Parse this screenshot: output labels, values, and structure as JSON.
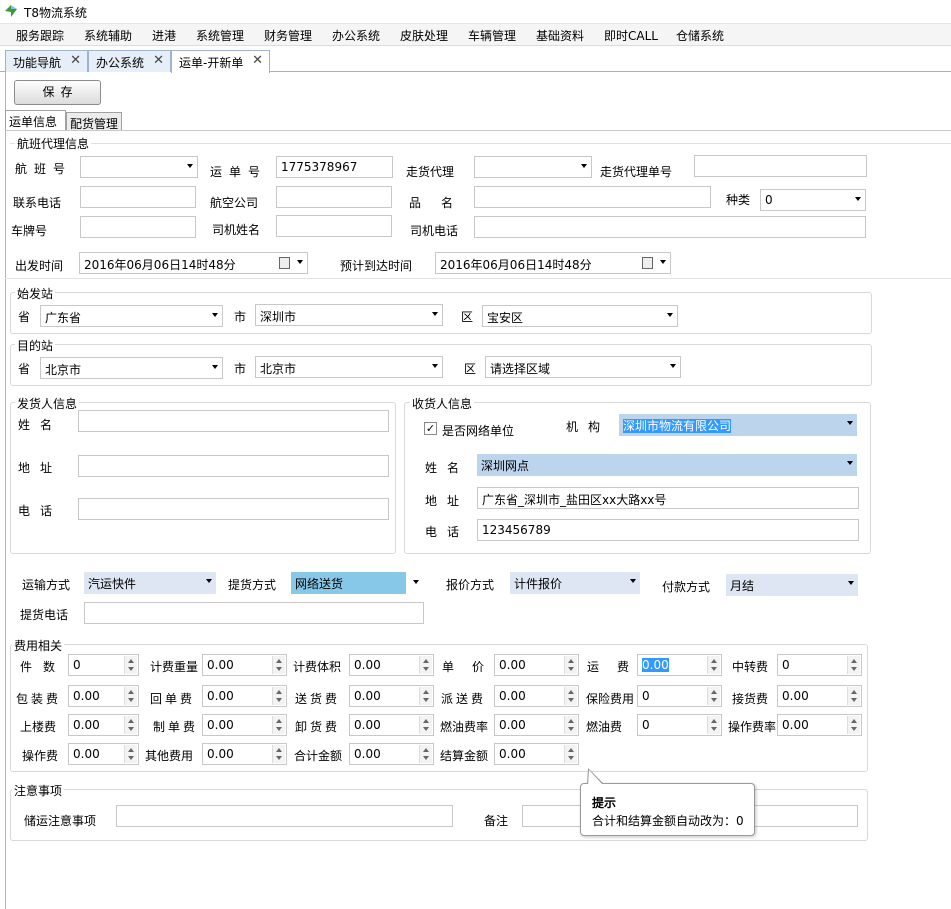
{
  "app": {
    "title": "T8物流系统"
  },
  "menu": [
    "服务跟踪",
    "系统辅助",
    "进港",
    "系统管理",
    "财务管理",
    "办公系统",
    "皮肤处理",
    "车辆管理",
    "基础资料",
    "即时CALL",
    "仓储系统"
  ],
  "tabs": [
    {
      "label": "功能导航",
      "close": "✕"
    },
    {
      "label": "办公系统",
      "close": "✕"
    },
    {
      "label": "运单-开新单",
      "close": "✕"
    }
  ],
  "toolbar": {
    "save_label": "保存"
  },
  "subtabs": [
    "运单信息",
    "配货管理"
  ],
  "flight": {
    "group_title": "航班代理信息",
    "flight_no_label": "航班号",
    "flight_no": "",
    "waybill_no_label": "运单号",
    "waybill_no": "1775378967",
    "agent_label": "走货代理",
    "agent": "",
    "agent_bill_label": "走货代理单号",
    "agent_bill": "",
    "phone_label": "联系电话",
    "phone": "",
    "airline_label": "航空公司",
    "airline": "",
    "goods_name_label": "品名",
    "goods_name": "",
    "type_label": "种类",
    "type": "0",
    "plate_label": "车牌号",
    "plate": "",
    "driver_label": "司机姓名",
    "driver": "",
    "driver_phone_label": "司机电话",
    "driver_phone": "",
    "depart_label": "出发时间",
    "depart": "2016年06月06日14时48分",
    "arrive_label": "预计到达时间",
    "arrive": "2016年06月06日14时48分"
  },
  "origin": {
    "group_title": "始发站",
    "prov_label": "省",
    "prov": "广东省",
    "city_label": "市",
    "city": "深圳市",
    "dist_label": "区",
    "dist": "宝安区"
  },
  "dest": {
    "group_title": "目的站",
    "prov_label": "省",
    "prov": "北京市",
    "city_label": "市",
    "city": "北京市",
    "dist_label": "区",
    "dist": "请选择区域"
  },
  "sender": {
    "group_title": "发货人信息",
    "name_label": "姓名",
    "name": "",
    "addr_label": "地址",
    "addr": "",
    "phone_label": "电话",
    "phone": ""
  },
  "receiver": {
    "group_title": "收货人信息",
    "network_label": "是否网络单位",
    "network_checked": "✓",
    "org_label": "机构",
    "org": "深圳市物流有限公司",
    "name_label": "姓名",
    "name": "深圳网点",
    "addr_label": "地址",
    "addr": "广东省_深圳市_盐田区xx大路xx号",
    "phone_label": "电话",
    "phone": "123456789"
  },
  "shipping": {
    "transport_label": "运输方式",
    "transport": "汽运快件",
    "pickup_label": "提货方式",
    "pickup": "网络送货",
    "quote_label": "报价方式",
    "quote": "计件报价",
    "pay_label": "付款方式",
    "pay": "月结",
    "pickup_phone_label": "提货电话",
    "pickup_phone": ""
  },
  "fees": {
    "group_title": "费用相关",
    "rows": [
      [
        {
          "label": "件数",
          "value": "0"
        },
        {
          "label": "计费重量",
          "value": "0.00"
        },
        {
          "label": "计费体积",
          "value": "0.00"
        },
        {
          "label": "单价",
          "value": "0.00"
        },
        {
          "label": "运费",
          "value": "0.00"
        },
        {
          "label": "中转费",
          "value": "0"
        }
      ],
      [
        {
          "label": "包装费",
          "value": "0.00"
        },
        {
          "label": "回单费",
          "value": "0.00"
        },
        {
          "label": "送货费",
          "value": "0.00"
        },
        {
          "label": "派送费",
          "value": "0.00"
        },
        {
          "label": "保险费用",
          "value": "0"
        },
        {
          "label": "接货费",
          "value": "0.00"
        }
      ],
      [
        {
          "label": "上楼费",
          "value": "0.00"
        },
        {
          "label": "制单费",
          "value": "0.00"
        },
        {
          "label": "卸货费",
          "value": "0.00"
        },
        {
          "label": "燃油费率",
          "value": "0.00"
        },
        {
          "label": "燃油费",
          "value": "0"
        },
        {
          "label": "操作费率",
          "value": "0.00"
        }
      ],
      [
        {
          "label": "操作费",
          "value": "0.00"
        },
        {
          "label": "其他费用",
          "value": "0.00"
        },
        {
          "label": "合计金额",
          "value": "0.00"
        },
        {
          "label": "结算金额",
          "value": "0.00"
        }
      ]
    ]
  },
  "notes": {
    "group_title": "注意事项",
    "caution_label": "储运注意事项",
    "caution": "",
    "remark_label": "备注",
    "remark": ""
  },
  "tooltip": {
    "title": "提示",
    "text": "合计和结算金额自动改为：0"
  }
}
